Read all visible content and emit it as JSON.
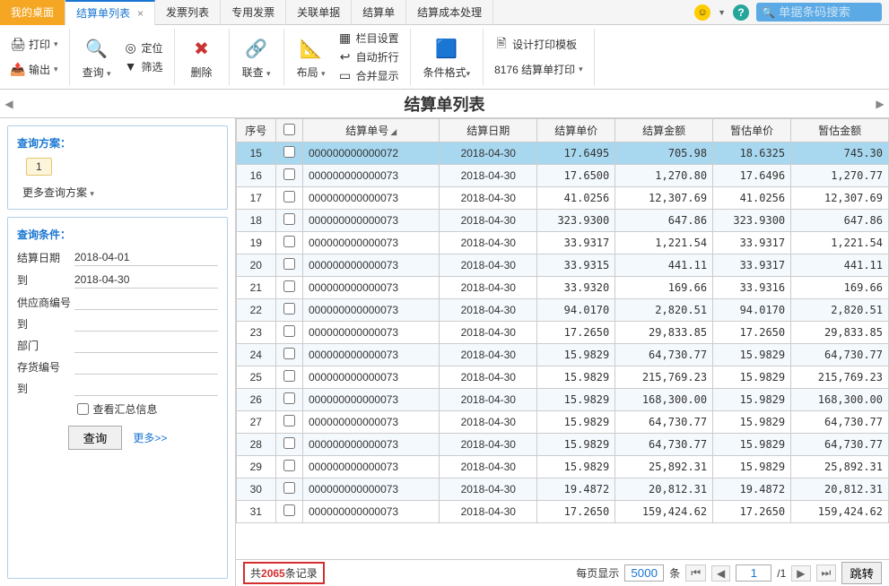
{
  "tabs": {
    "home": "我的桌面",
    "items": [
      "结算单列表",
      "发票列表",
      "专用发票",
      "关联单据",
      "结算单",
      "结算成本处理"
    ]
  },
  "search": {
    "placeholder": "单据条码搜索"
  },
  "toolbar": {
    "print": "打印",
    "export": "输出",
    "query": "查询",
    "locate": "定位",
    "filter": "筛选",
    "delete": "删除",
    "link": "联查",
    "layout": "布局",
    "colset": "栏目设置",
    "wrap": "自动折行",
    "merge": "合并显示",
    "condfmt": "条件格式",
    "designtmpl": "设计打印模板",
    "print8176": "8176 结算单打印"
  },
  "title": "结算单列表",
  "leftpanel": {
    "scheme_title": "查询方案：",
    "scheme_1": "1",
    "more_scheme": "更多查询方案",
    "cond_title": "查询条件：",
    "date_label": "结算日期",
    "date_from": "2018-04-01",
    "to_label": "到",
    "date_to": "2018-04-30",
    "supplier_label": "供应商编号",
    "supplier_to_label": "到",
    "dept_label": "部门",
    "stock_label": "存货编号",
    "stock_to_label": "到",
    "summary_label": "查看汇总信息",
    "btn_query": "查询",
    "btn_more": "更多>>"
  },
  "grid": {
    "headers": {
      "seq": "序号",
      "docno": "结算单号",
      "date": "结算日期",
      "unitprice": "结算单价",
      "amount": "结算金额",
      "estprice": "暂估单价",
      "estamount": "暂估金额"
    },
    "rows": [
      {
        "seq": "15",
        "docno": "000000000000072",
        "date": "2018-04-30",
        "up": "17.6495",
        "amt": "705.98",
        "ep": "18.6325",
        "ea": "745.30",
        "sel": true
      },
      {
        "seq": "16",
        "docno": "000000000000073",
        "date": "2018-04-30",
        "up": "17.6500",
        "amt": "1,270.80",
        "ep": "17.6496",
        "ea": "1,270.77"
      },
      {
        "seq": "17",
        "docno": "000000000000073",
        "date": "2018-04-30",
        "up": "41.0256",
        "amt": "12,307.69",
        "ep": "41.0256",
        "ea": "12,307.69"
      },
      {
        "seq": "18",
        "docno": "000000000000073",
        "date": "2018-04-30",
        "up": "323.9300",
        "amt": "647.86",
        "ep": "323.9300",
        "ea": "647.86"
      },
      {
        "seq": "19",
        "docno": "000000000000073",
        "date": "2018-04-30",
        "up": "33.9317",
        "amt": "1,221.54",
        "ep": "33.9317",
        "ea": "1,221.54"
      },
      {
        "seq": "20",
        "docno": "000000000000073",
        "date": "2018-04-30",
        "up": "33.9315",
        "amt": "441.11",
        "ep": "33.9317",
        "ea": "441.11"
      },
      {
        "seq": "21",
        "docno": "000000000000073",
        "date": "2018-04-30",
        "up": "33.9320",
        "amt": "169.66",
        "ep": "33.9316",
        "ea": "169.66"
      },
      {
        "seq": "22",
        "docno": "000000000000073",
        "date": "2018-04-30",
        "up": "94.0170",
        "amt": "2,820.51",
        "ep": "94.0170",
        "ea": "2,820.51"
      },
      {
        "seq": "23",
        "docno": "000000000000073",
        "date": "2018-04-30",
        "up": "17.2650",
        "amt": "29,833.85",
        "ep": "17.2650",
        "ea": "29,833.85"
      },
      {
        "seq": "24",
        "docno": "000000000000073",
        "date": "2018-04-30",
        "up": "15.9829",
        "amt": "64,730.77",
        "ep": "15.9829",
        "ea": "64,730.77"
      },
      {
        "seq": "25",
        "docno": "000000000000073",
        "date": "2018-04-30",
        "up": "15.9829",
        "amt": "215,769.23",
        "ep": "15.9829",
        "ea": "215,769.23"
      },
      {
        "seq": "26",
        "docno": "000000000000073",
        "date": "2018-04-30",
        "up": "15.9829",
        "amt": "168,300.00",
        "ep": "15.9829",
        "ea": "168,300.00"
      },
      {
        "seq": "27",
        "docno": "000000000000073",
        "date": "2018-04-30",
        "up": "15.9829",
        "amt": "64,730.77",
        "ep": "15.9829",
        "ea": "64,730.77"
      },
      {
        "seq": "28",
        "docno": "000000000000073",
        "date": "2018-04-30",
        "up": "15.9829",
        "amt": "64,730.77",
        "ep": "15.9829",
        "ea": "64,730.77"
      },
      {
        "seq": "29",
        "docno": "000000000000073",
        "date": "2018-04-30",
        "up": "15.9829",
        "amt": "25,892.31",
        "ep": "15.9829",
        "ea": "25,892.31"
      },
      {
        "seq": "30",
        "docno": "000000000000073",
        "date": "2018-04-30",
        "up": "19.4872",
        "amt": "20,812.31",
        "ep": "19.4872",
        "ea": "20,812.31"
      },
      {
        "seq": "31",
        "docno": "000000000000073",
        "date": "2018-04-30",
        "up": "17.2650",
        "amt": "159,424.62",
        "ep": "17.2650",
        "ea": "159,424.62"
      }
    ]
  },
  "footer": {
    "total_prefix": "共",
    "total_count": "2065",
    "total_suffix": "条记录",
    "page_size_label": "每页显示",
    "page_size": "5000",
    "unit": "条",
    "page_cur": "1",
    "page_total": "/1",
    "jump": "跳转"
  }
}
